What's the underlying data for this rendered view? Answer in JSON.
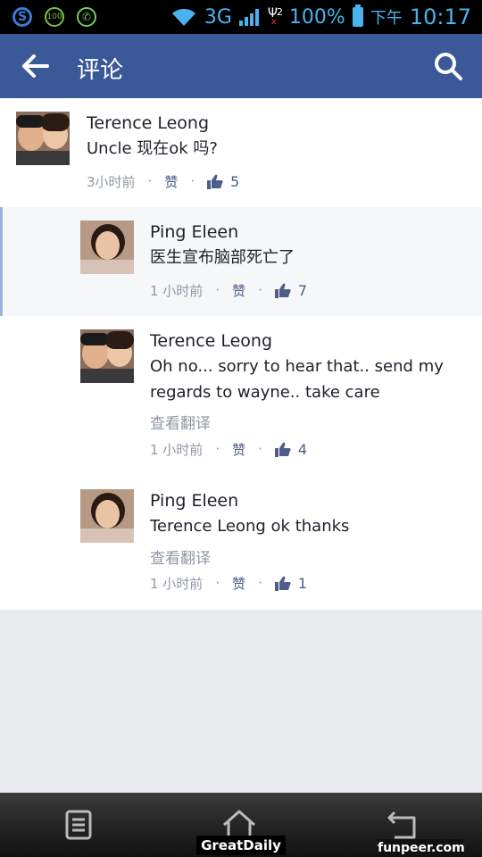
{
  "status_bar": {
    "net_type": "3G",
    "sim2": "2",
    "battery": "100%",
    "ampm": "下午",
    "time": "10:17",
    "badge_100": "100"
  },
  "header": {
    "title": "评论"
  },
  "comments": [
    {
      "name": "Terence Leong",
      "body": [
        "Uncle 现在ok 吗?"
      ],
      "time": "3小时前",
      "like_label": "赞",
      "likes": "5",
      "translate": ""
    },
    {
      "name": "Ping Eleen",
      "body": [
        "医生宣布脑部死亡了"
      ],
      "time": "1 小时前",
      "like_label": "赞",
      "likes": "7",
      "translate": ""
    },
    {
      "name": "Terence Leong",
      "body": [
        "Oh no... sorry to hear that.. send my",
        "regards to wayne.. take care"
      ],
      "time": "1 小时前",
      "like_label": "赞",
      "likes": "4",
      "translate": "查看翻译"
    },
    {
      "name": "Ping Eleen",
      "body": [
        "Terence Leong ok thanks"
      ],
      "time": "1 小时前",
      "like_label": "赞",
      "likes": "1",
      "translate": "查看翻译"
    }
  ],
  "watermarks": {
    "left": "GreatDaily",
    "right": "funpeer.com"
  },
  "colors": {
    "facebook_blue": "#3b5998",
    "meta_gray": "#9197a3",
    "like_blue": "#4e5d8a"
  }
}
